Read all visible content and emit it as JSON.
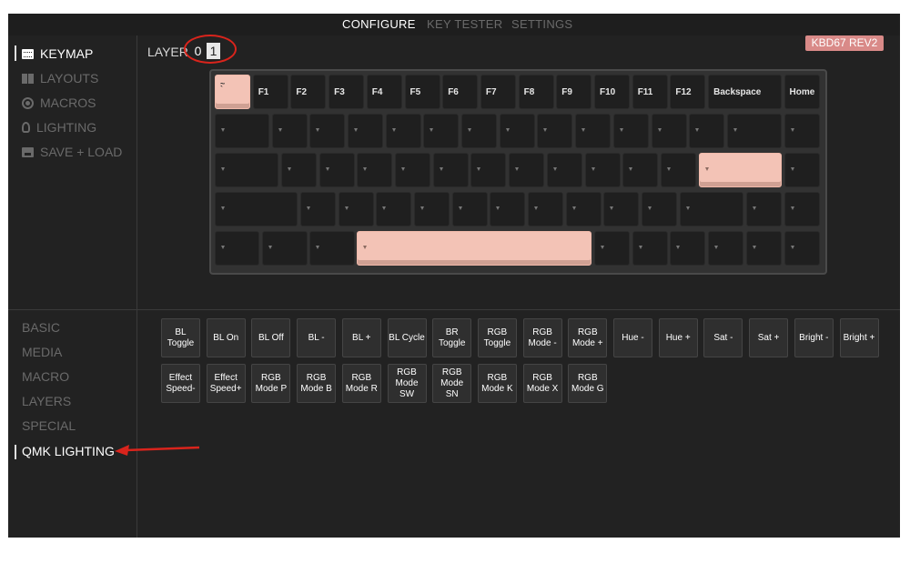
{
  "nav": {
    "configure": "CONFIGURE",
    "key_tester": "KEY TESTER",
    "settings": "SETTINGS"
  },
  "sidemenu": [
    {
      "label": "KEYMAP",
      "icon": "keyboard-icon",
      "active": true
    },
    {
      "label": "LAYOUTS",
      "icon": "grid-icon",
      "active": false
    },
    {
      "label": "MACROS",
      "icon": "record-icon",
      "active": false
    },
    {
      "label": "LIGHTING",
      "icon": "lightbulb-icon",
      "active": false
    },
    {
      "label": "SAVE + LOAD",
      "icon": "save-icon",
      "active": false
    }
  ],
  "layer": {
    "label": "LAYER",
    "options": [
      "0",
      "1"
    ],
    "selected": "1"
  },
  "keyboard_name": "KBD67 REV2",
  "keyboard": {
    "row1": [
      "~\n`",
      "F1",
      "F2",
      "F3",
      "F4",
      "F5",
      "F6",
      "F7",
      "F8",
      "F9",
      "F10",
      "F11",
      "F12",
      "Backspace",
      "Home"
    ]
  },
  "categories": [
    "BASIC",
    "MEDIA",
    "MACRO",
    "LAYERS",
    "SPECIAL",
    "QMK LIGHTING"
  ],
  "active_category": "QMK LIGHTING",
  "palette_row1": [
    "BL\nToggle",
    "BL On",
    "BL Off",
    "BL -",
    "BL +",
    "BL Cycle",
    "BR\nToggle",
    "RGB\nToggle",
    "RGB\nMode -",
    "RGB\nMode +",
    "Hue -",
    "Hue +",
    "Sat -",
    "Sat +",
    "Bright -",
    "Bright +"
  ],
  "palette_row2": [
    "Effect\nSpeed-",
    "Effect\nSpeed+",
    "RGB\nMode P",
    "RGB\nMode B",
    "RGB\nMode R",
    "RGB\nMode\nSW",
    "RGB\nMode\nSN",
    "RGB\nMode K",
    "RGB\nMode X",
    "RGB\nMode G"
  ],
  "colors": {
    "background": "#222222",
    "key": "#1f1f1f",
    "selected_key": "#f3c3b6",
    "badge": "#d98a88",
    "annotation": "#d9241c"
  }
}
